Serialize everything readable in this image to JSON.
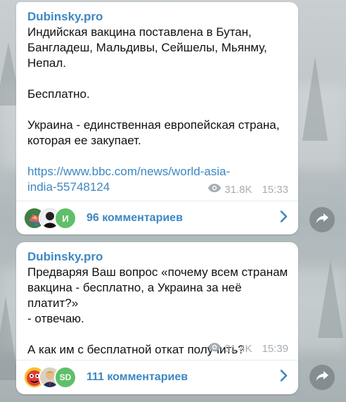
{
  "messages": [
    {
      "channel": "Dubinsky.pro",
      "text": "Индийская вакцина поставлена в Бутан,\nБангладеш, Мальдивы, Сейшелы, Мьянму,\nНепал.\n\nБесплатно.\n\nУкраина - единственная европейская страна,\nкоторая ее закупает.",
      "link": "https://www.bbc.com/news/world-asia-\nindia-55748124",
      "views": "31.8K",
      "time": "15:33",
      "comments_label": "96 комментариев",
      "avatars": [
        {
          "icon": "bird-avatar",
          "color": "#4f8a3c"
        },
        {
          "icon": "person-photo-avatar",
          "color": "#2d2d2d"
        },
        {
          "letter": "И",
          "color": "#5fbf6a"
        }
      ]
    },
    {
      "channel": "Dubinsky.pro",
      "text": "Предваряя Ваш вопрос «почему всем странам\nвакцина - бесплатно, а Украина за неё платит?»\n- отвечаю.\n\nА как им с бесплатной откат получить?",
      "views": "31.4K",
      "time": "15:39",
      "comments_label": "111 комментариев",
      "avatars": [
        {
          "icon": "red-character-avatar",
          "color": "#e53935"
        },
        {
          "icon": "person-photo-avatar",
          "color": "#c8a27c"
        },
        {
          "letter": "SD",
          "color": "#5fbf6a"
        }
      ]
    }
  ],
  "colors": {
    "accent": "#3d87c2",
    "meta": "#a6adb3",
    "bubble": "#ffffff"
  }
}
